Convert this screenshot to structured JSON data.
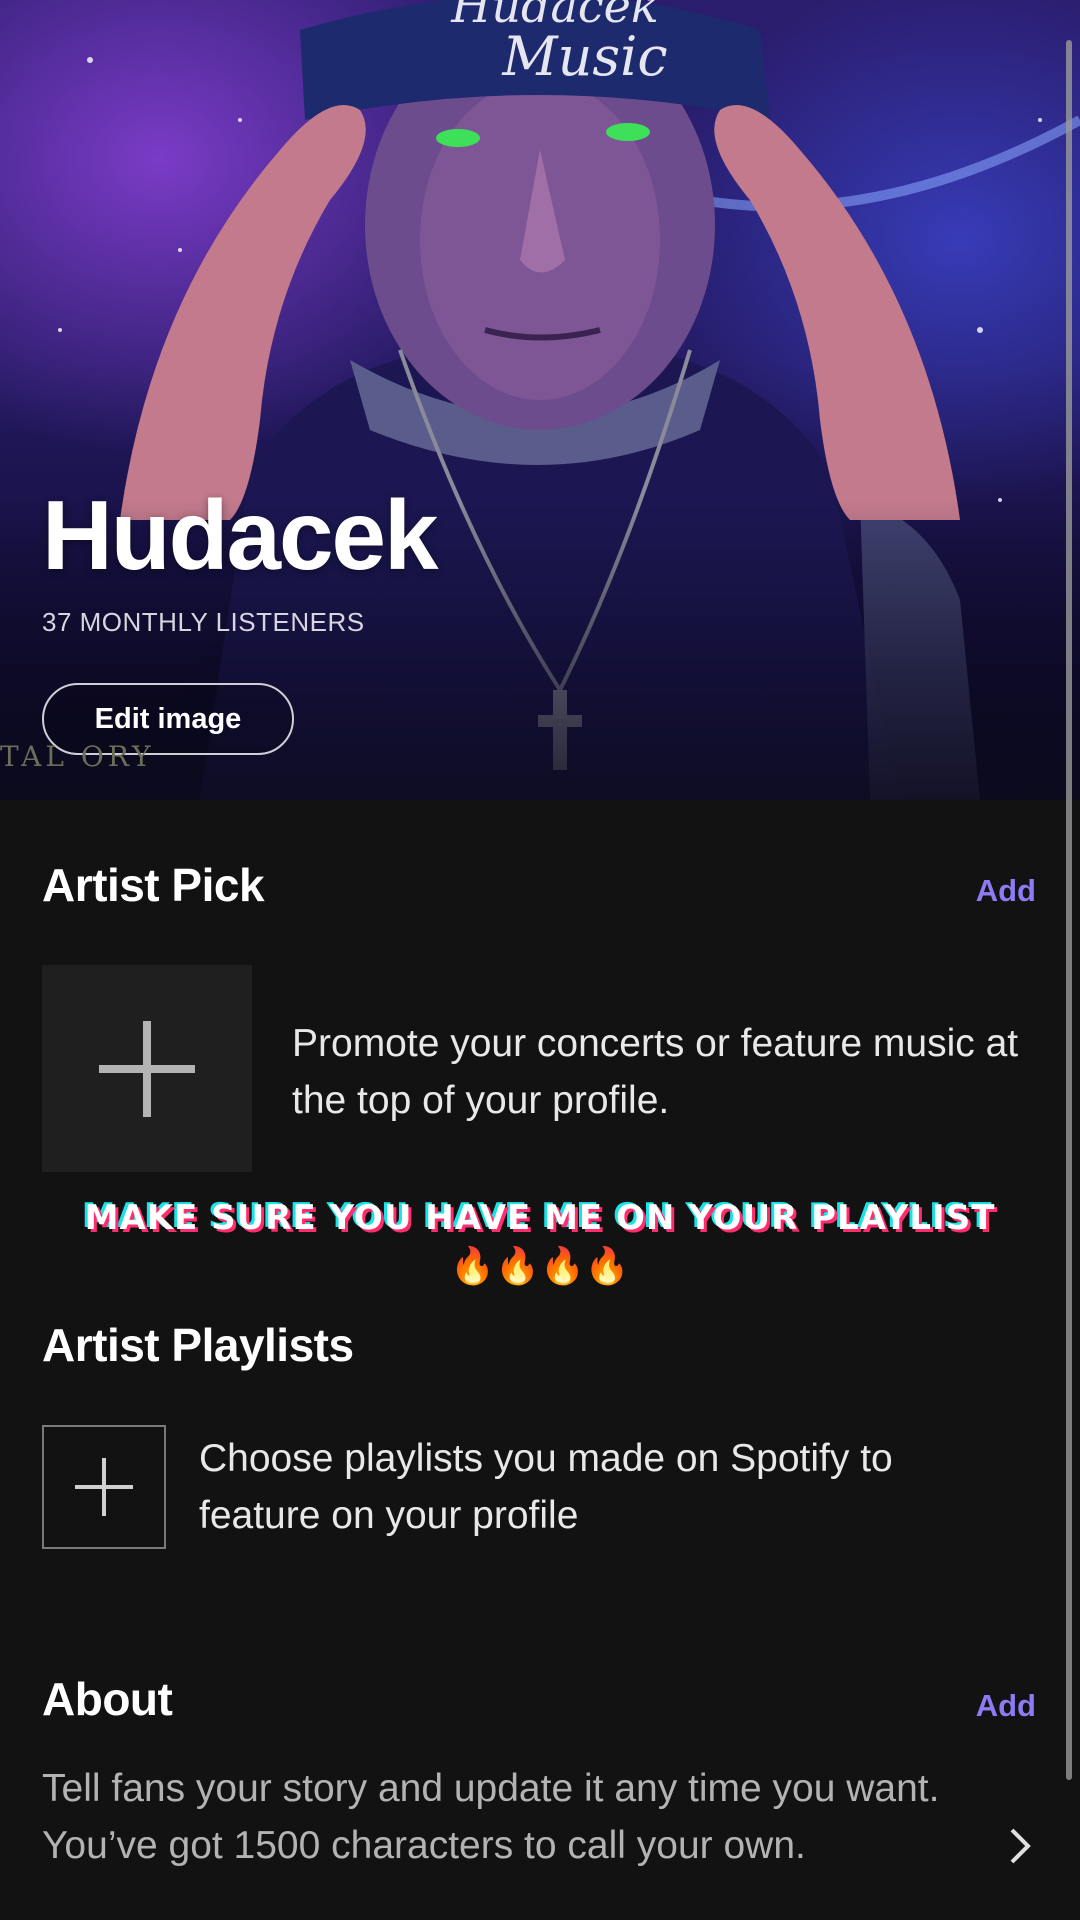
{
  "header": {
    "artist_name": "Hudacek",
    "monthly_listeners": "37 MONTHLY LISTENERS",
    "edit_image_label": "Edit image",
    "cap_text_line1": "Hudacek",
    "cap_text_line2": "Music",
    "side_text": "TAL ORY"
  },
  "artist_pick": {
    "title": "Artist Pick",
    "add_label": "Add",
    "description": "Promote your concerts or feature music at the top of your profile."
  },
  "promo": {
    "banner": "MAKE SURE YOU HAVE ME ON YOUR PLAYLIST",
    "emoji": "🔥🔥🔥🔥"
  },
  "artist_playlists": {
    "title": "Artist Playlists",
    "description": "Choose playlists you made on Spotify to feature on your profile"
  },
  "about": {
    "title": "About",
    "add_label": "Add",
    "description": "Tell fans your story and update it any time you want. You’ve got 1500 characters to call your own."
  },
  "colors": {
    "background": "#121212",
    "accent": "#8c7bf2",
    "tile": "#1f1f1f"
  }
}
